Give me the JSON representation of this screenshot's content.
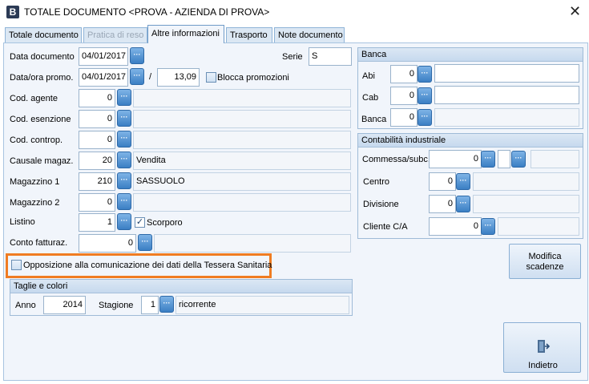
{
  "window": {
    "title": "TOTALE DOCUMENTO <PROVA - AZIENDA DI PROVA>",
    "app_icon": "B"
  },
  "tabs": [
    {
      "label": "Totale documento",
      "state": "normal"
    },
    {
      "label": "Pratica di reso",
      "state": "disabled"
    },
    {
      "label": "Altre informazioni",
      "state": "selected"
    },
    {
      "label": "Trasporto",
      "state": "normal"
    },
    {
      "label": "Note documento",
      "state": "normal"
    }
  ],
  "form": {
    "data_documento": {
      "label": "Data documento",
      "value": "04/01/2017"
    },
    "serie": {
      "label": "Serie",
      "value": "S"
    },
    "data_ora_promo": {
      "label": "Data/ora promo.",
      "date": "04/01/2017",
      "separator": "/",
      "time": "13,09"
    },
    "blocca_promozioni": {
      "label": "Blocca promozioni",
      "checked": false
    },
    "cod_agente": {
      "label": "Cod. agente",
      "value": "0",
      "desc": ""
    },
    "cod_esenzione": {
      "label": "Cod. esenzione",
      "value": "0",
      "desc": ""
    },
    "cod_controp": {
      "label": "Cod. controp.",
      "value": "0",
      "desc": ""
    },
    "causale_magaz": {
      "label": "Causale magaz.",
      "value": "20",
      "desc": "Vendita"
    },
    "magazzino1": {
      "label": "Magazzino 1",
      "value": "210",
      "desc": "SASSUOLO"
    },
    "magazzino2": {
      "label": "Magazzino 2",
      "value": "0",
      "desc": ""
    },
    "listino": {
      "label": "Listino",
      "value": "1",
      "scorporo_label": "Scorporo",
      "scorporo_checked": true
    },
    "conto_fatturaz": {
      "label": "Conto fatturaz.",
      "value": "0",
      "desc": ""
    },
    "opposizione": {
      "label": "Opposizione alla comunicazione dei dati della Tessera Sanitaria",
      "checked": false
    }
  },
  "taglie": {
    "title": "Taglie e colori",
    "anno_label": "Anno",
    "anno": "2014",
    "stagione_label": "Stagione",
    "stagione": "1",
    "stagione_desc": "ricorrente"
  },
  "banca": {
    "title": "Banca",
    "abi_label": "Abi",
    "abi": "0",
    "cab_label": "Cab",
    "cab": "0",
    "banca_label": "Banca",
    "banca": "0"
  },
  "contabilita": {
    "title": "Contabilità industriale",
    "commessa_label": "Commessa/subc.",
    "commessa": "0",
    "centro_label": "Centro",
    "centro": "0",
    "divisione_label": "Divisione",
    "divisione": "0",
    "cliente_label": "Cliente C/A",
    "cliente": "0"
  },
  "buttons": {
    "modifica_scadenze": "Modifica scadenze",
    "indietro": "Indietro",
    "lookup": "···"
  },
  "colors": {
    "highlight": "#f07c22",
    "accent": "#3b7fc4"
  }
}
